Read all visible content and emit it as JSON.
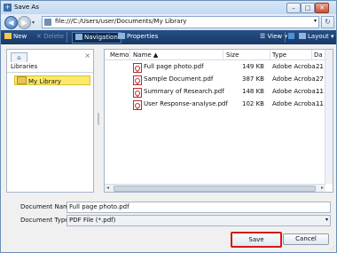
{
  "window": {
    "title": "Save As",
    "minimize_glyph": "–",
    "maximize_glyph": "□",
    "close_glyph": "✕"
  },
  "address": {
    "back_glyph": "◀",
    "forward_glyph": "▶",
    "path": "file:///C:/Users/user/Documents/My Library"
  },
  "toolbar": {
    "new_label": "New",
    "delete_label": "Delete",
    "navigation_label": "Navigation",
    "properties_label": "Properties",
    "view_label": "View ▾",
    "layout_label": "Layout ▾"
  },
  "sidebar": {
    "title": "Libraries",
    "items": [
      {
        "label": "My Library"
      }
    ]
  },
  "files": {
    "columns": [
      "Memo",
      "Name ▲",
      "Size",
      "Type",
      "Da"
    ],
    "rows": [
      {
        "name": "Full page photo.pdf",
        "size": "149 KB",
        "type": "Adobe Acroba…",
        "date": "21"
      },
      {
        "name": "Sample Document.pdf",
        "size": "387 KB",
        "type": "Adobe Acroba…",
        "date": "27"
      },
      {
        "name": "Summary of Research.pdf",
        "size": "148 KB",
        "type": "Adobe Acroba…",
        "date": "11"
      },
      {
        "name": "User Response-analyse.pdf",
        "size": "102 KB",
        "type": "Adobe Acroba…",
        "date": "11"
      }
    ]
  },
  "form": {
    "document_name_label": "Document Name:",
    "document_name_value": "Full page photo.pdf",
    "document_type_label": "Document Type:",
    "document_type_value": "PDF File (*.pdf)"
  },
  "buttons": {
    "save_label": "Save",
    "cancel_label": "Cancel"
  },
  "colors": {
    "toolbar_bg": "#1f4677",
    "selection_yellow": "#fbe96a",
    "save_highlight": "#d31818",
    "pdf_red": "#c22a2a"
  }
}
